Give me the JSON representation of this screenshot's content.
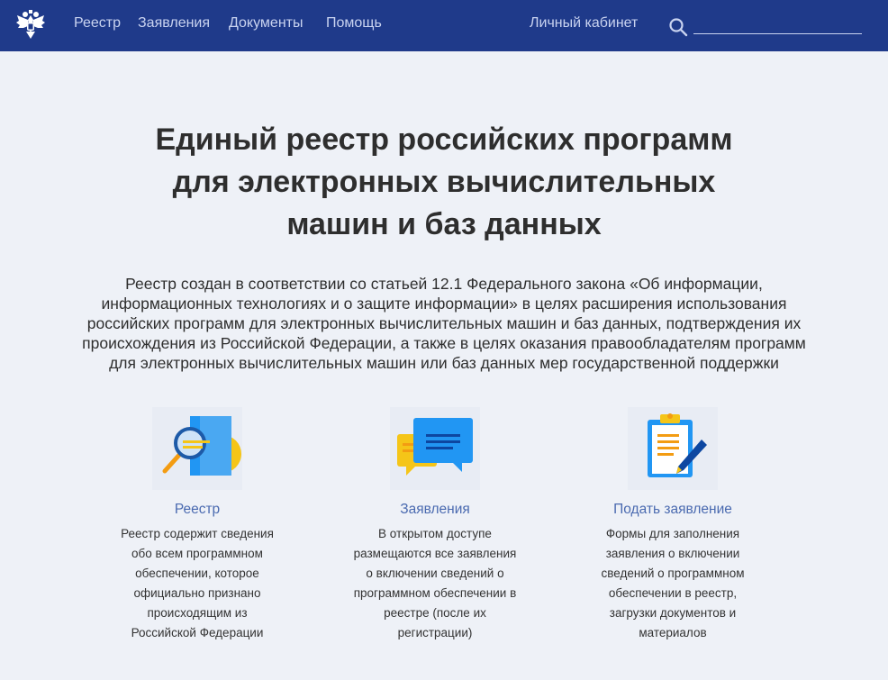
{
  "nav": {
    "links": [
      "Реестр",
      "Заявления",
      "Документы",
      "Помощь"
    ],
    "account": "Личный кабинет",
    "search_placeholder": ""
  },
  "hero": {
    "title_lines": [
      "Единый реестр российских программ",
      "для электронных вычислительных",
      "машин и баз данных"
    ],
    "lead_lines": [
      "Реестр создан в соответствии со статьей 12.1 Федерального закона «Об информации,",
      "информационных технологиях и о защите информации» в целях расширения использования",
      "российских программ для электронных вычислительных машин и баз данных, подтверждения их",
      "происхождения из Российской Федерации, а также в целях оказания правообладателям программ",
      "для электронных вычислительных машин или баз данных мер государственной поддержки"
    ]
  },
  "cards": [
    {
      "icon": "registry-search-icon",
      "title": "Реестр",
      "lines": [
        "Реестр содержит сведения",
        "обо всем программном",
        "обеспечении, которое",
        "официально признано",
        "происходящим из",
        "Российской Федерации"
      ]
    },
    {
      "icon": "chat-bubbles-icon",
      "title": "Заявления",
      "lines": [
        "В открытом доступе",
        "размещаются все заявления",
        "о включении сведений о",
        "программном обеспечении в",
        "реестре (после их",
        "регистрации)"
      ]
    },
    {
      "icon": "clipboard-pen-icon",
      "title": "Подать заявление",
      "lines": [
        "Формы для заполнения",
        "заявления о включении",
        "сведений о программном",
        "обеспечении в реестр,",
        "загрузки документов и",
        "материалов"
      ]
    }
  ],
  "colors": {
    "header_bg": "#1f3a8a",
    "page_bg": "#eef1f7",
    "link_color": "#4a6ab0",
    "accent_yellow": "#f5c518",
    "accent_blue": "#2196f3",
    "accent_orange": "#f39c12"
  }
}
